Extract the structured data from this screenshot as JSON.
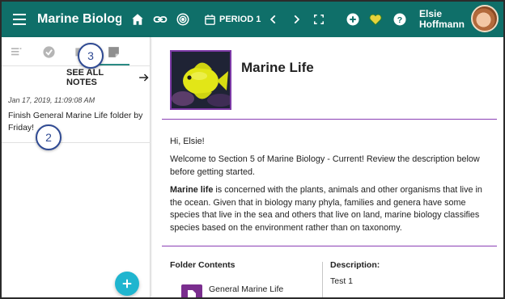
{
  "header": {
    "app_title": "Marine Biolog…",
    "period_label": "PERIOD 1",
    "user_first": "Elsie",
    "user_last": "Hoffmann"
  },
  "colors": {
    "header_bg": "#0f6f69",
    "accent_purple": "#7d3aa6",
    "fab": "#1fb5cf",
    "badge_border": "#2f4a93"
  },
  "icons": {
    "menu": "hamburger-icon",
    "home": "home-icon",
    "link": "link-icon",
    "target": "target-icon",
    "calendar": "calendar-icon",
    "prev": "chevron-left-icon",
    "next": "chevron-right-icon",
    "fullscreen": "fullscreen-icon",
    "add": "add-circle-icon",
    "heart": "heart-icon",
    "help": "help-icon"
  },
  "left_panel": {
    "tabs": [
      "list-tab",
      "check-tab",
      "folder-tab",
      "notes-tab"
    ],
    "see_all_notes": "SEE ALL NOTES",
    "note": {
      "timestamp": "Jan 17, 2019, 11:09:08 AM",
      "text": "Finish General Marine Life folder by Friday!"
    },
    "badge_notes": "3",
    "badge_note_item": "2"
  },
  "content": {
    "folder_title": "Marine Life",
    "greeting": "Hi, Elsie!",
    "welcome": "Welcome to Section 5 of Marine Biology - Current! Review the description below before getting started.",
    "body_bold": "Marine life",
    "body_rest": " is concerned with the plants, animals and other organisms that live in the ocean. Given that in biology many phyla, families and genera have some species that live in the sea and others that live on land, marine biology classifies species based on the environment rather than on taxonomy.",
    "folder_contents_label": "Folder Contents",
    "description_label": "Description:",
    "description_value": "Test 1",
    "folder_item": "General Marine Life"
  }
}
